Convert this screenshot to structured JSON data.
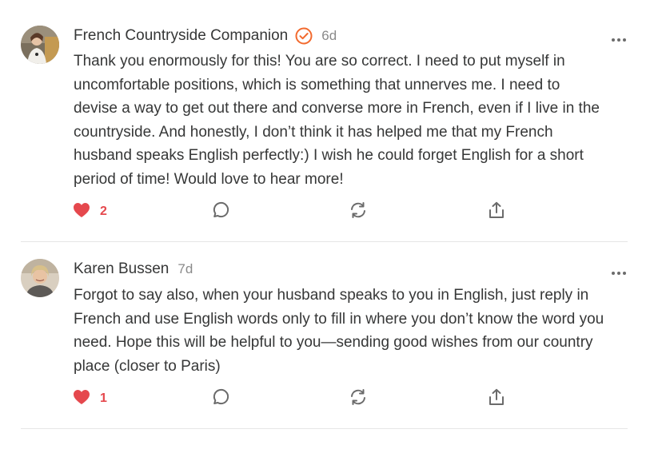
{
  "comments": [
    {
      "author": "French Countryside Companion",
      "verified": true,
      "date": "6d",
      "text": "Thank you enormously for this! You are so correct. I need to put myself in\nuncomfortable positions, which is something that unnerves me. I need to\ndevise a way to get out there and converse more in French, even if I live in the\ncountryside. And honestly, I don’t think it has helped me that my French\nhusband speaks English perfectly:) I wish he could forget English for a short\nperiod of time! Would love to hear more!",
      "likes": "2",
      "icons": [
        "heart-icon",
        "comment-bubble-icon",
        "restack-icon",
        "share-icon",
        "more-icon"
      ]
    },
    {
      "author": "Karen Bussen",
      "verified": false,
      "date": "7d",
      "text": "Forgot to say also, when your husband speaks to you in English, just reply in\nFrench and use English words only to fill in where you don’t know the word you\nneed. Hope this will be helpful to you—sending good wishes from our country\nplace (closer to Paris)",
      "likes": "1",
      "icons": [
        "heart-icon",
        "comment-bubble-icon",
        "restack-icon",
        "share-icon",
        "more-icon"
      ]
    }
  ],
  "colors": {
    "heart": "#e5484d",
    "verified_badge": "#f26a2e",
    "text": "#363737",
    "muted": "#8a8a8a",
    "icon": "#6b6b6b",
    "divider": "#e6e6e6"
  }
}
